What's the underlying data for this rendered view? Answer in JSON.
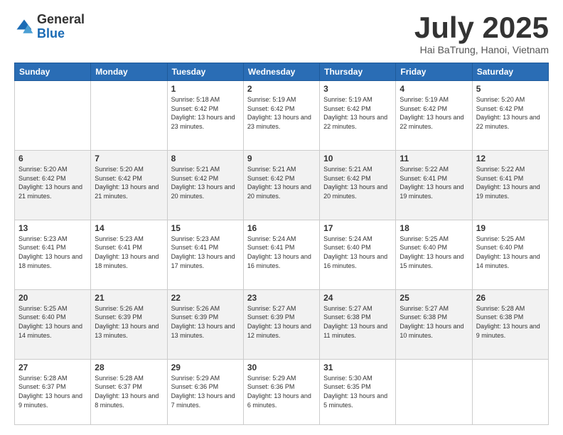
{
  "logo": {
    "general": "General",
    "blue": "Blue"
  },
  "header": {
    "month": "July 2025",
    "location": "Hai BaTrung, Hanoi, Vietnam"
  },
  "weekdays": [
    "Sunday",
    "Monday",
    "Tuesday",
    "Wednesday",
    "Thursday",
    "Friday",
    "Saturday"
  ],
  "weeks": [
    [
      {
        "day": "",
        "info": ""
      },
      {
        "day": "",
        "info": ""
      },
      {
        "day": "1",
        "info": "Sunrise: 5:18 AM\nSunset: 6:42 PM\nDaylight: 13 hours and 23 minutes."
      },
      {
        "day": "2",
        "info": "Sunrise: 5:19 AM\nSunset: 6:42 PM\nDaylight: 13 hours and 23 minutes."
      },
      {
        "day": "3",
        "info": "Sunrise: 5:19 AM\nSunset: 6:42 PM\nDaylight: 13 hours and 22 minutes."
      },
      {
        "day": "4",
        "info": "Sunrise: 5:19 AM\nSunset: 6:42 PM\nDaylight: 13 hours and 22 minutes."
      },
      {
        "day": "5",
        "info": "Sunrise: 5:20 AM\nSunset: 6:42 PM\nDaylight: 13 hours and 22 minutes."
      }
    ],
    [
      {
        "day": "6",
        "info": "Sunrise: 5:20 AM\nSunset: 6:42 PM\nDaylight: 13 hours and 21 minutes."
      },
      {
        "day": "7",
        "info": "Sunrise: 5:20 AM\nSunset: 6:42 PM\nDaylight: 13 hours and 21 minutes."
      },
      {
        "day": "8",
        "info": "Sunrise: 5:21 AM\nSunset: 6:42 PM\nDaylight: 13 hours and 20 minutes."
      },
      {
        "day": "9",
        "info": "Sunrise: 5:21 AM\nSunset: 6:42 PM\nDaylight: 13 hours and 20 minutes."
      },
      {
        "day": "10",
        "info": "Sunrise: 5:21 AM\nSunset: 6:42 PM\nDaylight: 13 hours and 20 minutes."
      },
      {
        "day": "11",
        "info": "Sunrise: 5:22 AM\nSunset: 6:41 PM\nDaylight: 13 hours and 19 minutes."
      },
      {
        "day": "12",
        "info": "Sunrise: 5:22 AM\nSunset: 6:41 PM\nDaylight: 13 hours and 19 minutes."
      }
    ],
    [
      {
        "day": "13",
        "info": "Sunrise: 5:23 AM\nSunset: 6:41 PM\nDaylight: 13 hours and 18 minutes."
      },
      {
        "day": "14",
        "info": "Sunrise: 5:23 AM\nSunset: 6:41 PM\nDaylight: 13 hours and 18 minutes."
      },
      {
        "day": "15",
        "info": "Sunrise: 5:23 AM\nSunset: 6:41 PM\nDaylight: 13 hours and 17 minutes."
      },
      {
        "day": "16",
        "info": "Sunrise: 5:24 AM\nSunset: 6:41 PM\nDaylight: 13 hours and 16 minutes."
      },
      {
        "day": "17",
        "info": "Sunrise: 5:24 AM\nSunset: 6:40 PM\nDaylight: 13 hours and 16 minutes."
      },
      {
        "day": "18",
        "info": "Sunrise: 5:25 AM\nSunset: 6:40 PM\nDaylight: 13 hours and 15 minutes."
      },
      {
        "day": "19",
        "info": "Sunrise: 5:25 AM\nSunset: 6:40 PM\nDaylight: 13 hours and 14 minutes."
      }
    ],
    [
      {
        "day": "20",
        "info": "Sunrise: 5:25 AM\nSunset: 6:40 PM\nDaylight: 13 hours and 14 minutes."
      },
      {
        "day": "21",
        "info": "Sunrise: 5:26 AM\nSunset: 6:39 PM\nDaylight: 13 hours and 13 minutes."
      },
      {
        "day": "22",
        "info": "Sunrise: 5:26 AM\nSunset: 6:39 PM\nDaylight: 13 hours and 13 minutes."
      },
      {
        "day": "23",
        "info": "Sunrise: 5:27 AM\nSunset: 6:39 PM\nDaylight: 13 hours and 12 minutes."
      },
      {
        "day": "24",
        "info": "Sunrise: 5:27 AM\nSunset: 6:38 PM\nDaylight: 13 hours and 11 minutes."
      },
      {
        "day": "25",
        "info": "Sunrise: 5:27 AM\nSunset: 6:38 PM\nDaylight: 13 hours and 10 minutes."
      },
      {
        "day": "26",
        "info": "Sunrise: 5:28 AM\nSunset: 6:38 PM\nDaylight: 13 hours and 9 minutes."
      }
    ],
    [
      {
        "day": "27",
        "info": "Sunrise: 5:28 AM\nSunset: 6:37 PM\nDaylight: 13 hours and 9 minutes."
      },
      {
        "day": "28",
        "info": "Sunrise: 5:28 AM\nSunset: 6:37 PM\nDaylight: 13 hours and 8 minutes."
      },
      {
        "day": "29",
        "info": "Sunrise: 5:29 AM\nSunset: 6:36 PM\nDaylight: 13 hours and 7 minutes."
      },
      {
        "day": "30",
        "info": "Sunrise: 5:29 AM\nSunset: 6:36 PM\nDaylight: 13 hours and 6 minutes."
      },
      {
        "day": "31",
        "info": "Sunrise: 5:30 AM\nSunset: 6:35 PM\nDaylight: 13 hours and 5 minutes."
      },
      {
        "day": "",
        "info": ""
      },
      {
        "day": "",
        "info": ""
      }
    ]
  ]
}
